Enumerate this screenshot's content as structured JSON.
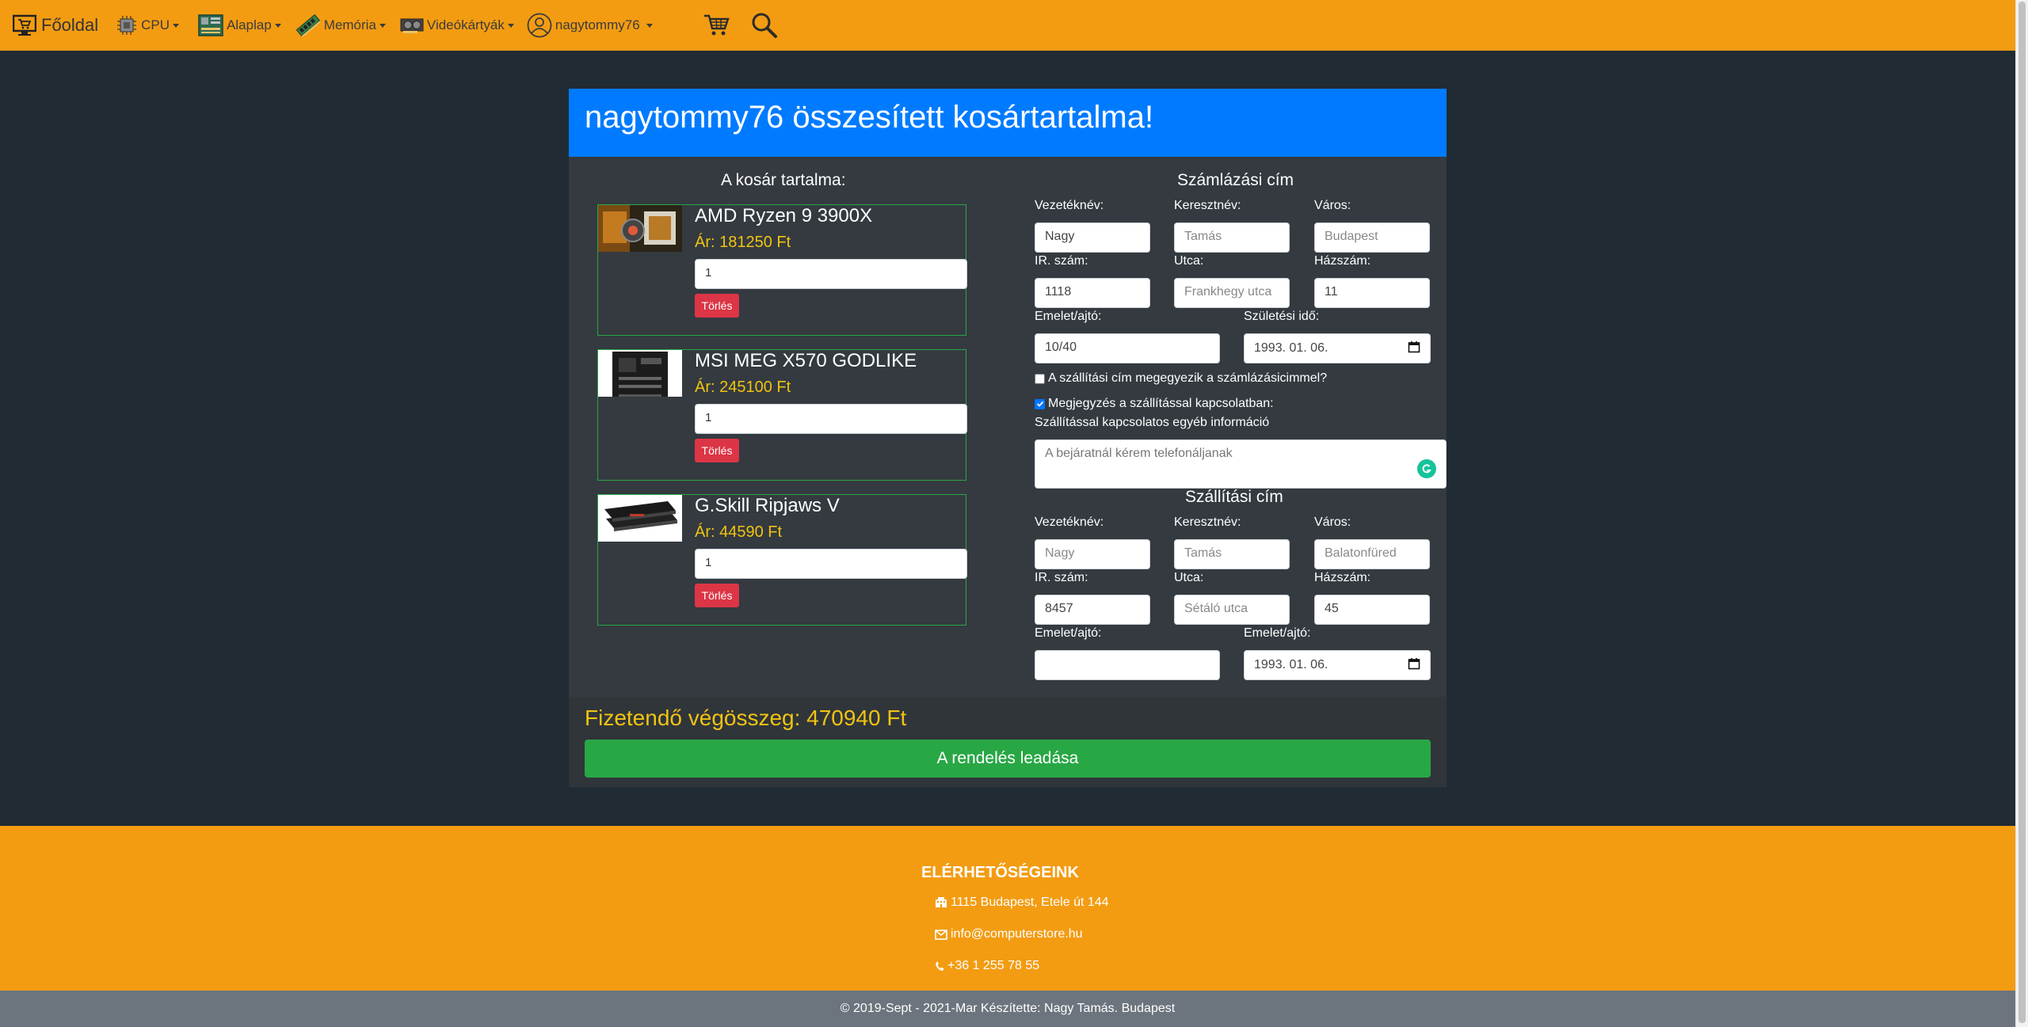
{
  "navbar": {
    "home_label": "Főoldal",
    "items": [
      {
        "label": "CPU",
        "icon": "cpu-icon"
      },
      {
        "label": "Alaplap",
        "icon": "motherboard-icon"
      },
      {
        "label": "Memória",
        "icon": "ram-icon"
      },
      {
        "label": "Videókártyák",
        "icon": "gpu-icon"
      },
      {
        "label": "nagytommy76",
        "icon": "user-icon"
      }
    ],
    "cart_icon": "cart-icon",
    "search_icon": "search-icon",
    "color": "#f39c12"
  },
  "card": {
    "title": "nagytommy76 összesített kosártartalma!",
    "header_color": "#007bff",
    "cart_heading": "A kosár tartalma:",
    "items": [
      {
        "name": "AMD Ryzen 9 3900X",
        "price": "Ár: 181250 Ft",
        "qty": "1",
        "delete_label": "Törlés"
      },
      {
        "name": "MSI MEG X570 GODLIKE",
        "price": "Ár: 245100 Ft",
        "qty": "1",
        "delete_label": "Törlés"
      },
      {
        "name": "G.Skill Ripjaws V",
        "price": "Ár: 44590 Ft",
        "qty": "1",
        "delete_label": "Törlés"
      }
    ],
    "billing": {
      "title": "Számlázási cím",
      "lastname_label": "Vezetéknév:",
      "lastname_value": "Nagy",
      "firstname_label": "Keresztnév:",
      "firstname_placeholder": "Tamás",
      "city_label": "Város:",
      "city_placeholder": "Budapest",
      "zip_label": "IR. szám:",
      "zip_value": "1118",
      "street_label": "Utca:",
      "street_placeholder": "Frankhegy utca",
      "house_label": "Házszám:",
      "house_value": "11",
      "floor_label": "Emelet/ajtó:",
      "floor_value": "10/40",
      "birth_label": "Születési idő:",
      "birth_value": "1993. 01. 06."
    },
    "same_address_label": "A szállítási cím megegyezik a számlázásicimmel?",
    "note_checkbox_label": "Megjegyzés a szállítással kapcsolatban:",
    "note_info_label": "Szállítással kapcsolatos egyéb információ",
    "note_text": "A bejáratnál kérem telefonáljanak",
    "shipping": {
      "title": "Szállítási cím",
      "lastname_label": "Vezetéknév:",
      "lastname_placeholder": "Nagy",
      "firstname_label": "Keresztnév:",
      "firstname_placeholder": "Tamás",
      "city_label": "Város:",
      "city_placeholder": "Balatonfüred",
      "zip_label": "IR. szám:",
      "zip_value": "8457",
      "street_label": "Utca:",
      "street_placeholder": "Sétáló utca",
      "house_label": "Házszám:",
      "house_value": "45",
      "floor_label": "Emelet/ajtó:",
      "floor_value": "",
      "floor2_label": "Emelet/ajtó:",
      "date_value": "1993. 01. 06."
    },
    "total": "Fizetendő végösszeg: 470940 Ft",
    "order_button": "A rendelés leadása"
  },
  "footer": {
    "title": "ELÉRHETŐSÉGEINK",
    "address": "1115 Budapest, Etele út 144",
    "email": "info@computerstore.hu",
    "phone": "+36 1 255 78 55",
    "copyright": "© 2019-Sept - 2021-Mar Készítette: Nagy Tamás. Budapest"
  }
}
